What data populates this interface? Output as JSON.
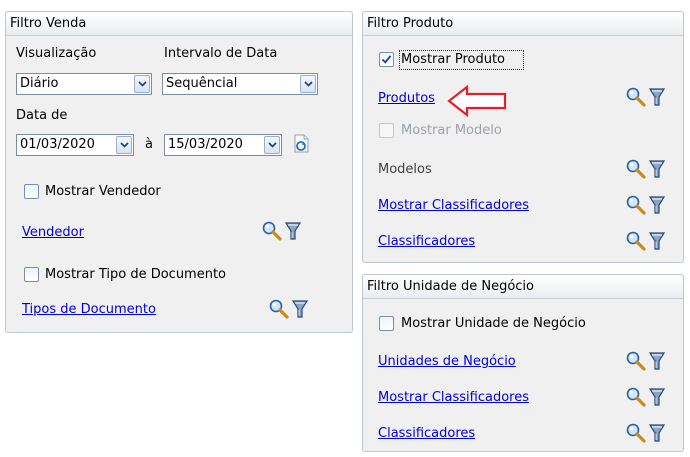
{
  "filtro_venda": {
    "title": "Filtro Venda",
    "visualizacao_label": "Visualização",
    "visualizacao_value": "Diário",
    "intervalo_label": "Intervalo de Data",
    "intervalo_value": "Sequêncial",
    "data_de_label": "Data de",
    "date_from": "01/03/2020",
    "date_separator": "à",
    "date_to": "15/03/2020",
    "mostrar_vendedor": "Mostrar Vendedor",
    "vendedor_link": "Vendedor",
    "mostrar_tipo_documento": "Mostrar Tipo de Documento",
    "tipos_documento_link": "Tipos de Documento"
  },
  "filtro_produto": {
    "title": "Filtro Produto",
    "mostrar_produto": "Mostrar Produto",
    "produtos_link": "Produtos",
    "mostrar_modelo": "Mostrar Modelo",
    "modelos_label": "Modelos",
    "mostrar_classificadores_link": "Mostrar Classificadores",
    "classificadores_link": "Classificadores"
  },
  "filtro_unidade": {
    "title": "Filtro Unidade de Negócio",
    "mostrar_unidade": "Mostrar Unidade de Negócio",
    "unidades_link": "Unidades de Negócio",
    "mostrar_classificadores_link": "Mostrar Classificadores",
    "classificadores_link": "Classificadores"
  },
  "colors": {
    "link": "#0000dd",
    "arrow": "#e0202a",
    "panel_bg": "#f0f0f0",
    "panel_border": "#bfc7d0"
  }
}
